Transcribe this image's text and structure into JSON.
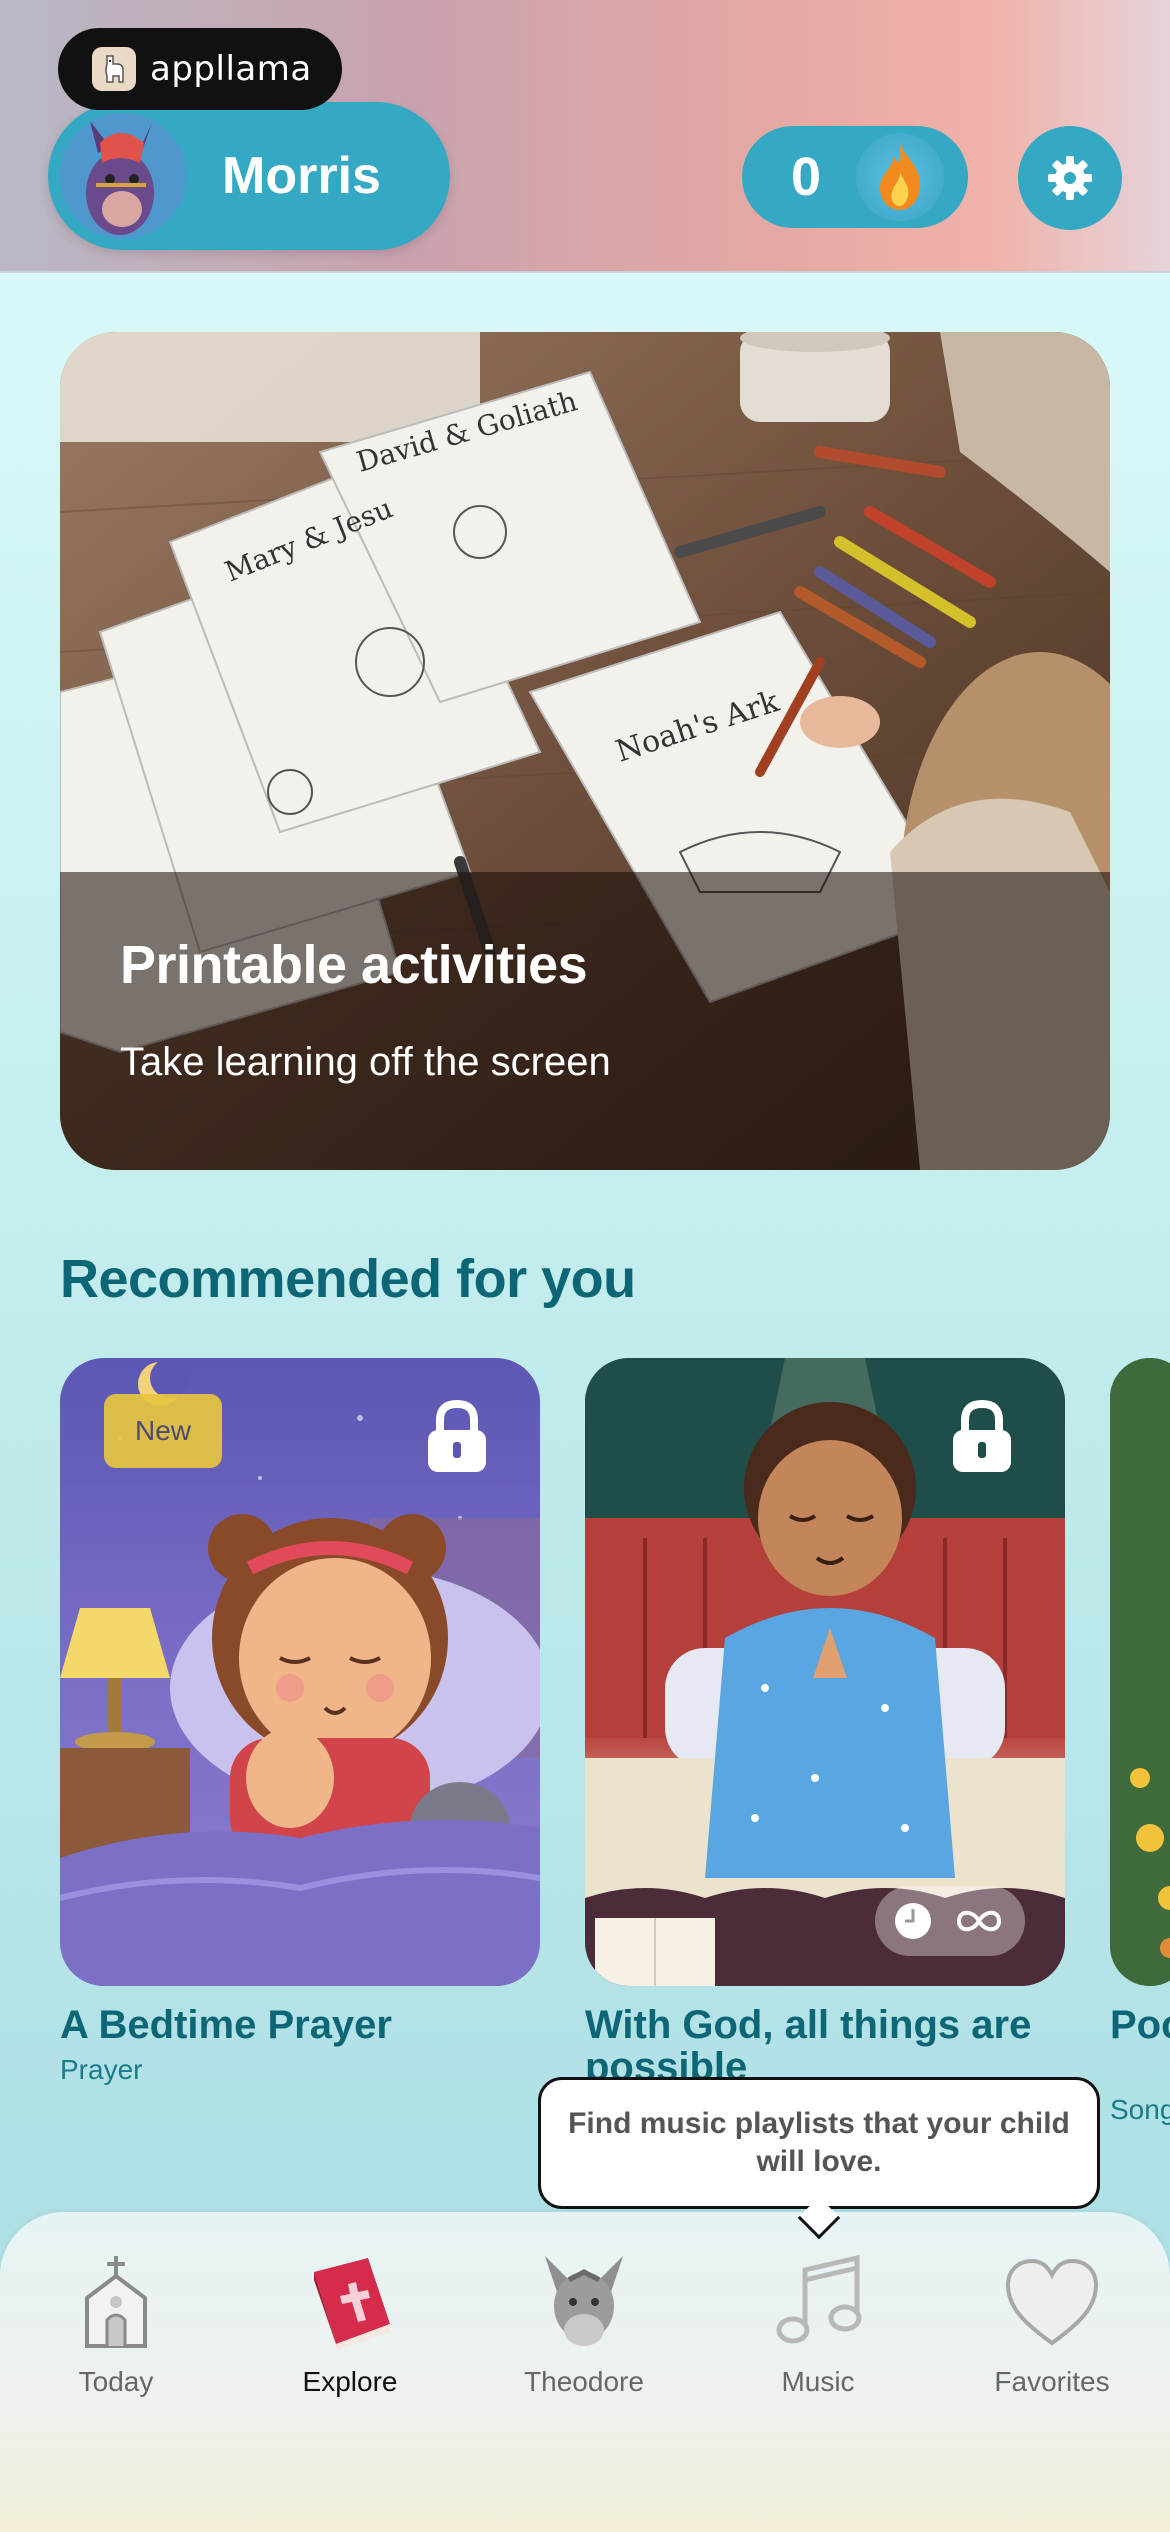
{
  "brand": {
    "name": "appllama"
  },
  "profile": {
    "name": "Morris"
  },
  "streak": {
    "count": "0"
  },
  "hero": {
    "title": "Printable activities",
    "subtitle": "Take learning off the screen"
  },
  "recommended": {
    "title": "Recommended for you",
    "items": [
      {
        "title": "A Bedtime Prayer",
        "category": "Prayer",
        "badge": "New",
        "locked": true
      },
      {
        "title": "With God, all things are possible",
        "category": "",
        "locked": true,
        "duration_icon": "infinity"
      },
      {
        "title": "Poc Pra",
        "category": "Song",
        "locked": false
      }
    ]
  },
  "tooltip": {
    "text": "Find music playlists that your child will love."
  },
  "tabs": [
    {
      "label": "Today",
      "icon": "church-icon"
    },
    {
      "label": "Explore",
      "icon": "bible-icon",
      "active": true
    },
    {
      "label": "Theodore",
      "icon": "donkey-icon"
    },
    {
      "label": "Music",
      "icon": "music-note-icon"
    },
    {
      "label": "Favorites",
      "icon": "heart-icon"
    }
  ],
  "colors": {
    "accent": "#35a8c4",
    "heading": "#0d6675",
    "badge_new": "#e7c640"
  }
}
